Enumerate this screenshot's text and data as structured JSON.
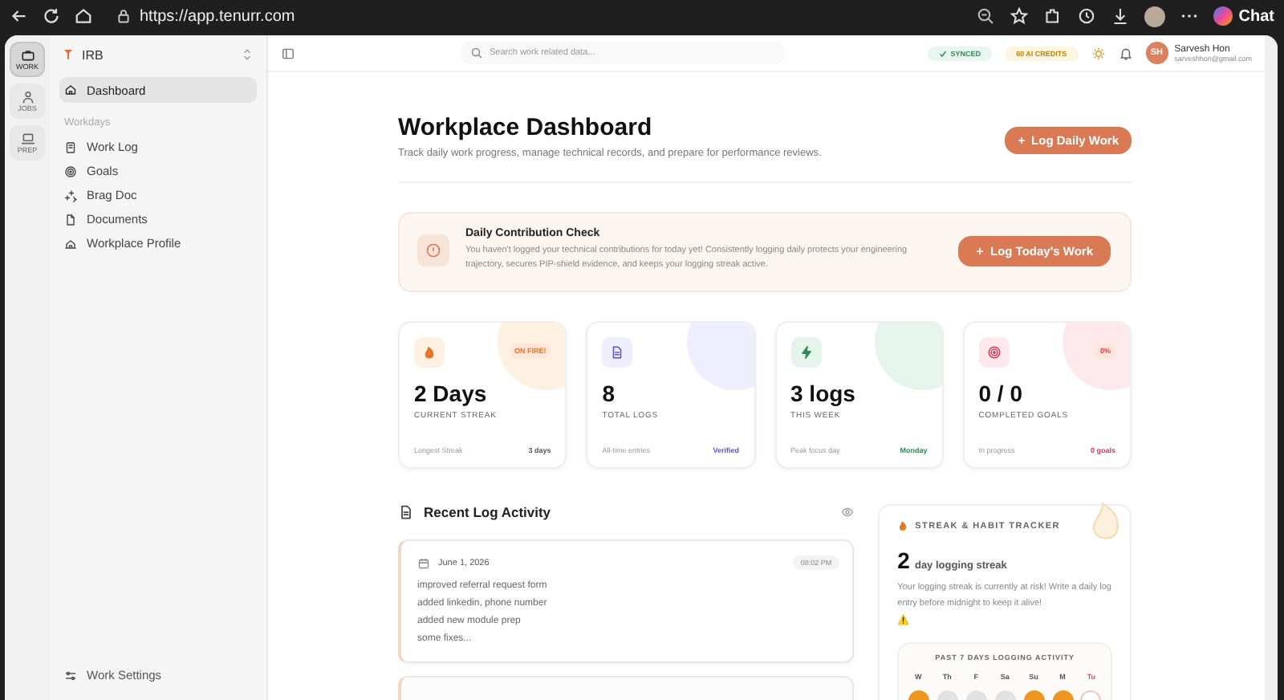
{
  "browser": {
    "url": "https://app.tenurr.com",
    "chat": "Chat"
  },
  "rail": [
    {
      "label": "WORK",
      "selected": true
    },
    {
      "label": "JOBS",
      "selected": false
    },
    {
      "label": "PREP",
      "selected": false
    }
  ],
  "sidebar": {
    "org": "IRB",
    "items": [
      {
        "label": "Dashboard",
        "selected": true
      }
    ],
    "section": "Workdays",
    "section_items": [
      {
        "label": "Work Log",
        "selected": false
      },
      {
        "label": "Goals",
        "selected": false
      },
      {
        "label": "Brag Doc",
        "selected": false
      },
      {
        "label": "Documents",
        "selected": false
      },
      {
        "label": "Workplace Profile",
        "selected": false
      }
    ],
    "footer": "Work Settings"
  },
  "topbar": {
    "search_placeholder": "Search work related data...",
    "synced": "SYNCED",
    "credits": "60 AI CREDITS",
    "user": {
      "initials": "SH",
      "name": "Sarvesh Hon",
      "email": "sarveshhon@gmail.com"
    }
  },
  "header": {
    "title": "Workplace Dashboard",
    "subtitle": "Track daily work progress, manage technical records, and prepare for performance reviews.",
    "button": "Log Daily Work"
  },
  "alert": {
    "title": "Daily Contribution Check",
    "text": "You haven't logged your technical contributions for today yet! Consistently logging daily protects your engineering trajectory, secures PIP-shield evidence, and keeps your logging streak active.",
    "button": "Log Today's Work"
  },
  "stats": [
    {
      "color": "#e0782a",
      "value": "2 Days",
      "label": "CURRENT STREAK",
      "badge": "ON FIRE!",
      "foot_label": "Longest Streak",
      "foot_value": "3 days"
    },
    {
      "color": "#5b4fe0",
      "value": "8",
      "label": "TOTAL LOGS",
      "foot_label": "All-time entries",
      "foot_value": "Verified"
    },
    {
      "color": "#2e8b57",
      "value": "3 logs",
      "label": "THIS WEEK",
      "foot_label": "Peak focus day",
      "foot_value": "Monday"
    },
    {
      "color": "#d43a5a",
      "value": "0 / 0",
      "label": "COMPLETED GOALS",
      "badge": "0%",
      "foot_label": "In progress",
      "foot_value": "0 goals"
    }
  ],
  "recent": {
    "title": "Recent Log Activity",
    "entries": [
      {
        "date": "June 1, 2026",
        "time": "08:02 PM",
        "lines": [
          "improved referral request form",
          "added linkedin, phone number",
          "added new module prep",
          "some fixes..."
        ]
      }
    ]
  },
  "streak": {
    "title": "STREAK & HABIT TRACKER",
    "count": "2",
    "unit": "day logging streak",
    "text": "Your logging streak is currently at risk! Write a daily log entry before midnight to keep it alive!",
    "warning": "⚠️",
    "activity_title": "PAST 7 DAYS LOGGING ACTIVITY",
    "days": [
      {
        "label": "W",
        "logged": true,
        "today": false
      },
      {
        "label": "Th",
        "logged": false,
        "today": false
      },
      {
        "label": "F",
        "logged": false,
        "today": false
      },
      {
        "label": "Sa",
        "logged": false,
        "today": false
      },
      {
        "label": "Su",
        "logged": true,
        "today": false
      },
      {
        "label": "M",
        "logged": true,
        "today": false
      },
      {
        "label": "Tu",
        "logged": false,
        "today": true
      }
    ]
  }
}
